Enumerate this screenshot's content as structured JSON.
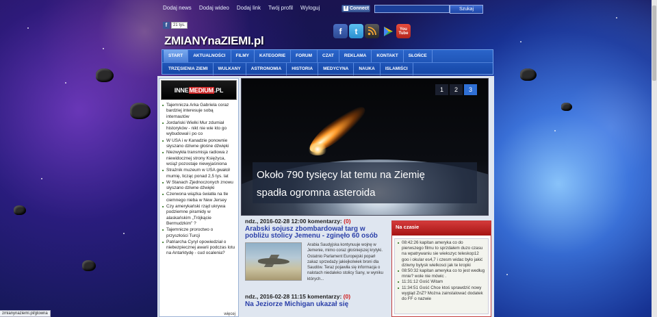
{
  "top_links": [
    "Dodaj news",
    "Dodaj wideo",
    "Dodaj link",
    "Twój profil",
    "Wyloguj"
  ],
  "facebook_connect": "Connect",
  "search": {
    "placeholder": "",
    "button": "Szukaj"
  },
  "like_count": "21 tys.",
  "site_title": "ZMIANYnaZIEMI.pl",
  "social_icons": [
    "facebook-icon",
    "twitter-icon",
    "rss-icon",
    "play-icon",
    "youtube-icon"
  ],
  "menu_row1": [
    "START",
    "AKTUALNOŚCI",
    "FILMY",
    "KATEGORIE",
    "FORUM",
    "CZAT",
    "REKLAMA",
    "KONTAKT",
    "SŁOŃCE"
  ],
  "menu_row2": [
    "TRZĘSIENIA ZIEMI",
    "WULKANY",
    "ASTRONOMIA",
    "HISTORIA",
    "MEDYCYNA",
    "NAUKA",
    "ISLAMIŚCI"
  ],
  "banner": {
    "left": "INNE",
    "mid": "MEDIUM",
    "right": ".PL"
  },
  "sidebar_items": [
    "Tajemnicza Arka Gabriela coraz bardziej interesuje sobą internautów",
    "Jordański Wielki Mur zdumiał historyków - nikt nie wie kto go wybudował i po co",
    "W USA i w Kanadzie ponownie słyszano dziwne głośne dźwięki",
    "Niezwykła transmisja radiowa z niewidocznej strony Księżyca, wciąż pozostaje niewyjaśniona",
    "Strażnik muzeum w USA gwałcił mumię, licząc ponad 2,5 tys. lat",
    "W Stanach Zjednoczonych znowu słyszano dziwne dźwięki",
    "Czerwona wiązka światła na tle ciemnego nieba w New Jersey",
    "Czy amerykański rząd ukrywa podziemne piramidy w alaskańskim „Trójkącie Bermudzkim” ?",
    "Tajemnicze proroctwo o przyszłości Turcji",
    "Patriarcha Cyryl opowiedział o niebezpiecznej awarii podczas lotu na Antarktydę - cud ocalenia?"
  ],
  "sidebar_more": "więcej",
  "slider": {
    "pages": [
      "1",
      "2",
      "3"
    ],
    "active": 2,
    "caption_line1": "Około 790 tysięcy lat temu na Ziemię",
    "caption_line2": "spadła ogromna asteroida"
  },
  "articles": [
    {
      "date": "ndz., 2016-02-28 12:00",
      "comments_label": "komentarzy:",
      "comments": "(0)",
      "title": "Arabski sojusz zbombardował targ w pobliżu stolicy Jemenu - zginęło 60 osób",
      "excerpt": "Arabia Saudyjska kontynuuje wojnę w Jemenie, mimo coraz głośniejszej krytyki. Ostatnio Parlament Europejski poparł zakaz sprzedaży jakiejkolwiek broni dla Saudów. Teraz pojawiła się informacja o nalotach niedaleko stolicy Sany, w wyniku których..."
    },
    {
      "date": "ndz., 2016-02-28 11:15",
      "comments_label": "komentarzy:",
      "comments": "(0)",
      "title": "Na Jeziorze Michigan ukazał się"
    }
  ],
  "na_czasie": {
    "title": "Na czasie",
    "items": [
      "08:42:26 kapitan ameryka co do pierwszego filmu to sprzdałem duzo czasu na wpatrywaniu sie wiekszyc teleskop12 goo i okular es4,7 i czesm widac było jakić dziwny bylysk wielkosci jak te kropki",
      "08:50:32 kapitan ameryka co to jest według mnie? wole nie mówic .",
      "11:31:12 Gość Witam",
      "11:34:51 Gość Chce ktoś sprawdzić nowy wygląd ZnZ? Można zainstalować dodatek do FF o nazwie"
    ]
  },
  "status_url": "zmianynaziemi.pl/glowna"
}
